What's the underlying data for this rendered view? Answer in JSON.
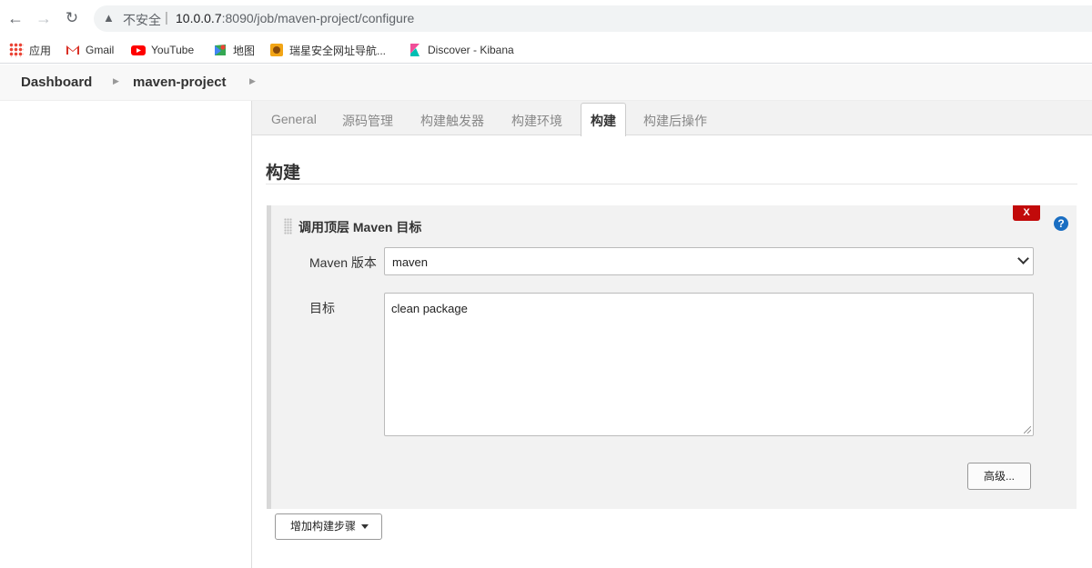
{
  "browser": {
    "insecure_label": "不安全",
    "url_host": "10.0.0.7",
    "url_rest": ":8090/job/maven-project/configure"
  },
  "bookmarks": [
    {
      "label": "应用",
      "icon": "apps-grid-icon"
    },
    {
      "label": "Gmail",
      "icon": "gmail-icon"
    },
    {
      "label": "YouTube",
      "icon": "youtube-icon"
    },
    {
      "label": "地图",
      "icon": "maps-icon"
    },
    {
      "label": "瑞星安全网址导航...",
      "icon": "rising-icon"
    },
    {
      "label": "Discover - Kibana",
      "icon": "kibana-icon"
    }
  ],
  "breadcrumb": {
    "items": [
      "Dashboard",
      "maven-project"
    ]
  },
  "tabs": [
    {
      "label": "General",
      "active": false
    },
    {
      "label": "源码管理",
      "active": false
    },
    {
      "label": "构建触发器",
      "active": false
    },
    {
      "label": "构建环境",
      "active": false
    },
    {
      "label": "构建",
      "active": true
    },
    {
      "label": "构建后操作",
      "active": false
    }
  ],
  "section": {
    "title": "构建"
  },
  "build_step": {
    "title": "调用顶层 Maven 目标",
    "delete_label": "X",
    "help_label": "?",
    "maven_version_label": "Maven 版本",
    "maven_version_value": "maven",
    "goals_label": "目标",
    "goals_value": "clean package",
    "advanced_label": "高级..."
  },
  "add_step_label": "增加构建步骤",
  "colors": {
    "delete": "#c20a0a",
    "help": "#1a6ec2"
  }
}
